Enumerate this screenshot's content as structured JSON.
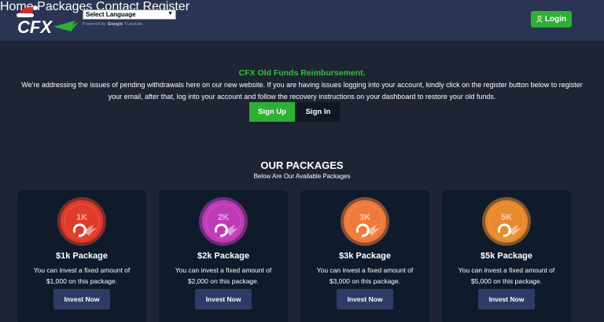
{
  "header": {
    "logo_text": "CFX",
    "language_select": "Select Language",
    "powered_by": "Powered by",
    "google": "Google",
    "translate": "Translate",
    "nav": [
      "Home",
      "Packages",
      "Contact",
      "Register"
    ],
    "login_label": "Login"
  },
  "hero": {
    "title": "CFX Old Funds Reimbursement.",
    "text": "We're addressing the issues of pending withdrawals here on our new website. If you are having issues logging into your account, kindly click on the register button below to register your email, after that, log into your account and follow the recovery instructions on your dashboard to restore your old funds.",
    "signup_label": "Sign Up",
    "signin_label": "Sign In"
  },
  "packages": {
    "title": "OUR PACKAGES",
    "subtitle": "Below Are Our Available Packages",
    "items": [
      {
        "badge": "1K",
        "title": "$1k Package",
        "desc": "You can invest a fixed amount of $1,000 on this package.",
        "button": "Invest Now",
        "color": "#e03a2a"
      },
      {
        "badge": "2K",
        "title": "$2k Package",
        "desc": "You can invest a fixed amount of $2,000 on this package.",
        "button": "Invest Now",
        "color": "#c03ab8"
      },
      {
        "badge": "3K",
        "title": "$3k Package",
        "desc": "You can invest a fixed amount of $3,000 on this package.",
        "button": "Invest Now",
        "color": "#f07a3a"
      },
      {
        "badge": "5K",
        "title": "$5k Package",
        "desc": "You can invest a fixed amount of $5,000 on this package.",
        "button": "Invest Now",
        "color": "#e8892e"
      }
    ]
  },
  "colors": {
    "accent": "#2db034",
    "header_bg": "#2a3553",
    "page_bg": "#1e2433",
    "card_bg": "#0f1b2a",
    "button_bg": "#2d3b66"
  }
}
